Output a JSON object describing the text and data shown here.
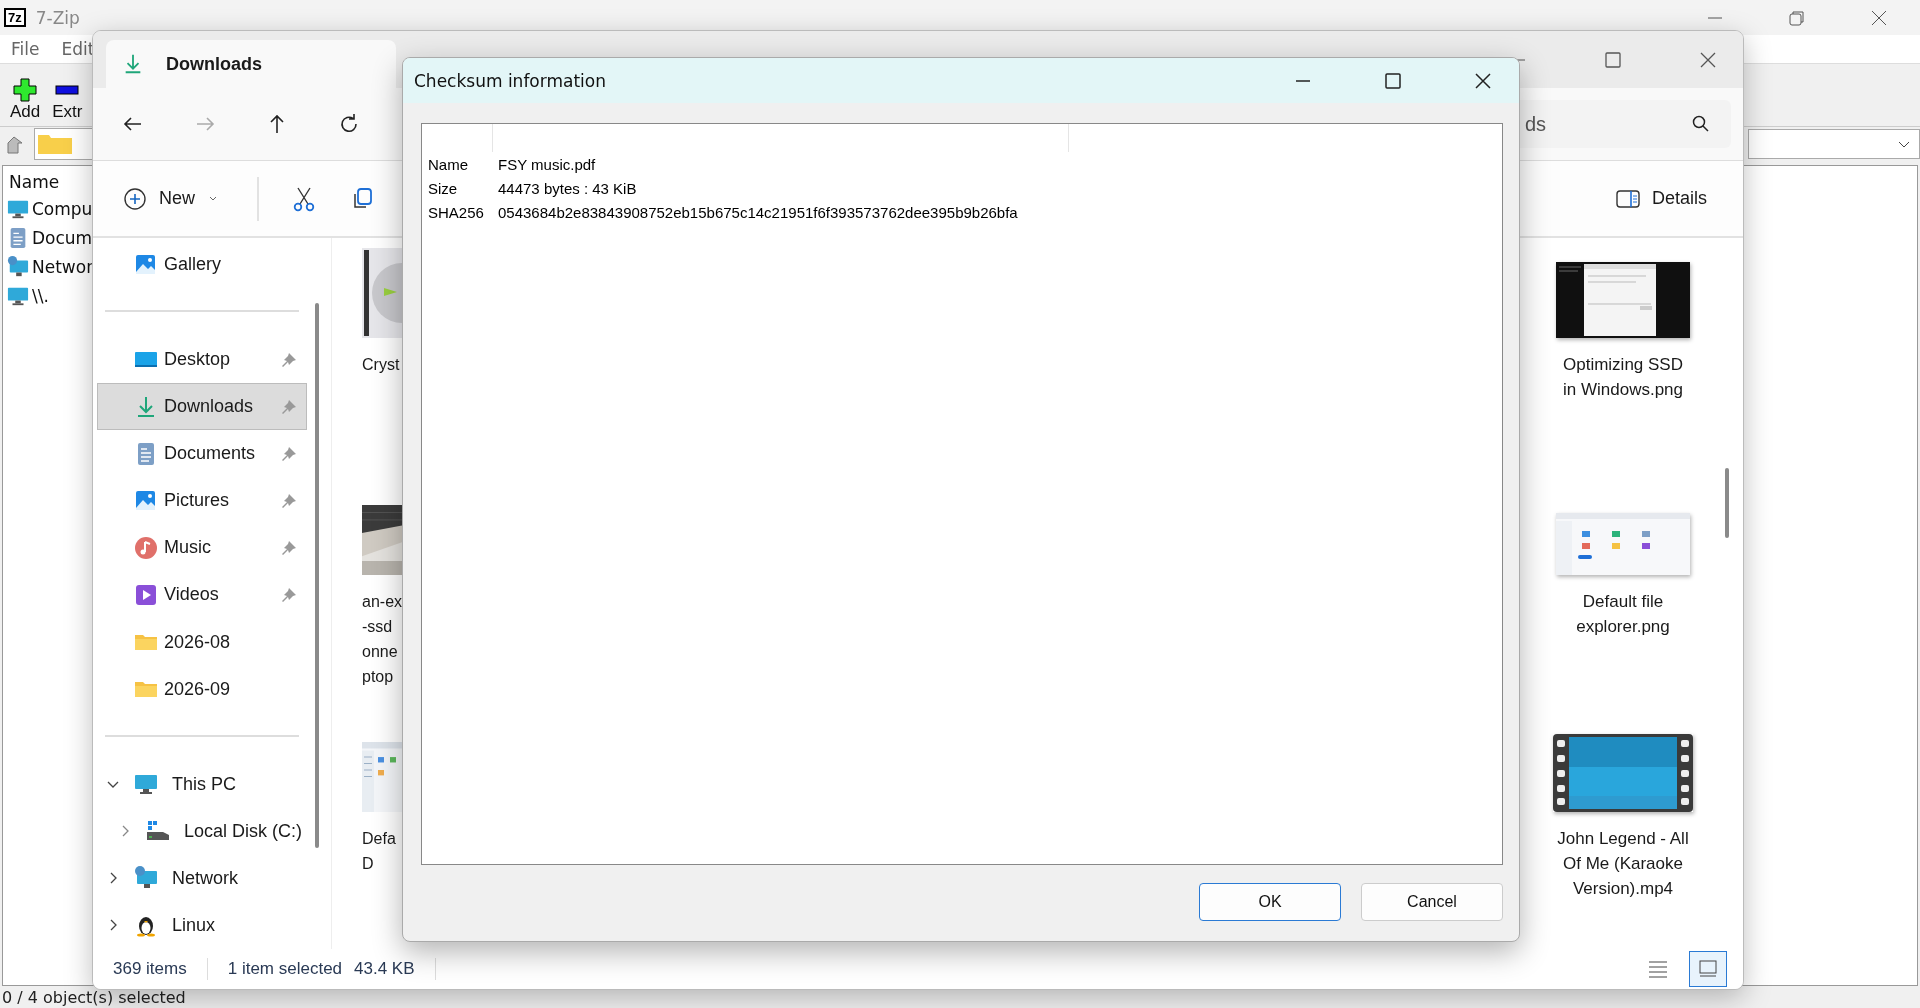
{
  "zip": {
    "logo": "7z",
    "title": "7-Zip",
    "menu": [
      "File",
      "Edit"
    ],
    "toolbar": [
      {
        "label": "Add",
        "kind": "add"
      },
      {
        "label": "Extr",
        "kind": "extract"
      }
    ],
    "list_header": "Name",
    "items": [
      {
        "label": "Compu",
        "kind": "computer"
      },
      {
        "label": "Docum",
        "kind": "documents"
      },
      {
        "label": "Networ",
        "kind": "network"
      },
      {
        "label": "\\\\.",
        "kind": "computer"
      }
    ],
    "status": "0 / 4 object(s) selected"
  },
  "explorer": {
    "tab": "Downloads",
    "search": {
      "value": "ds"
    },
    "new_label": "New",
    "details_label": "Details",
    "sidebar": {
      "top": [
        {
          "label": "Gallery",
          "kind": "gallery"
        }
      ],
      "quick": [
        {
          "label": "Desktop",
          "kind": "desktop",
          "pinned": true,
          "selected": false
        },
        {
          "label": "Downloads",
          "kind": "downloads",
          "pinned": true,
          "selected": true
        },
        {
          "label": "Documents",
          "kind": "documents",
          "pinned": true,
          "selected": false
        },
        {
          "label": "Pictures",
          "kind": "pictures",
          "pinned": true,
          "selected": false
        },
        {
          "label": "Music",
          "kind": "music",
          "pinned": true,
          "selected": false
        },
        {
          "label": "Videos",
          "kind": "videos",
          "pinned": true,
          "selected": false
        },
        {
          "label": "2026-08",
          "kind": "folder",
          "pinned": false,
          "selected": false
        },
        {
          "label": "2026-09",
          "kind": "folder",
          "pinned": false,
          "selected": false
        }
      ],
      "tree": [
        {
          "label": "This PC",
          "kind": "pc",
          "expanded": true,
          "children": [
            {
              "label": "Local Disk (C:)",
              "kind": "disk",
              "expanded": false
            }
          ]
        },
        {
          "label": "Network",
          "kind": "network",
          "expanded": false
        },
        {
          "label": "Linux",
          "kind": "linux",
          "expanded": false
        }
      ]
    },
    "files_left": [
      {
        "kind": "disc",
        "lines": [
          "Cryst"
        ]
      },
      {
        "kind": "picture",
        "lines": [
          "an-ex",
          "-ssd",
          "onne",
          "ptop"
        ]
      },
      {
        "kind": "screenshot",
        "lines": [
          "Defa",
          "D"
        ]
      }
    ],
    "files_right": [
      {
        "kind": "screenshot-dark",
        "lines": [
          "Optimizing SSD",
          "in Windows.png"
        ]
      },
      {
        "kind": "screenshot",
        "lines": [
          "Default file",
          "explorer.png"
        ]
      },
      {
        "kind": "video",
        "lines": [
          "John Legend - All",
          "Of Me (Karaoke",
          "Version).mp4"
        ]
      }
    ],
    "status": [
      "369 items",
      "1 item selected",
      "43.4 KB"
    ],
    "view_buttons": [
      {
        "kind": "details",
        "selected": false
      },
      {
        "kind": "tiles",
        "selected": true
      }
    ]
  },
  "dialog": {
    "title": "Checksum information",
    "rows": [
      {
        "label": "Name",
        "value": "FSY music.pdf"
      },
      {
        "label": "Size",
        "value": "44473 bytes : 43 KiB"
      },
      {
        "label": "SHA256",
        "value": "0543684b2e83843908752eb15b675c14c21951f6f393573762dee395b9b26bfa"
      }
    ],
    "buttons": [
      {
        "label": "OK",
        "default": true
      },
      {
        "label": "Cancel",
        "default": false
      }
    ]
  }
}
